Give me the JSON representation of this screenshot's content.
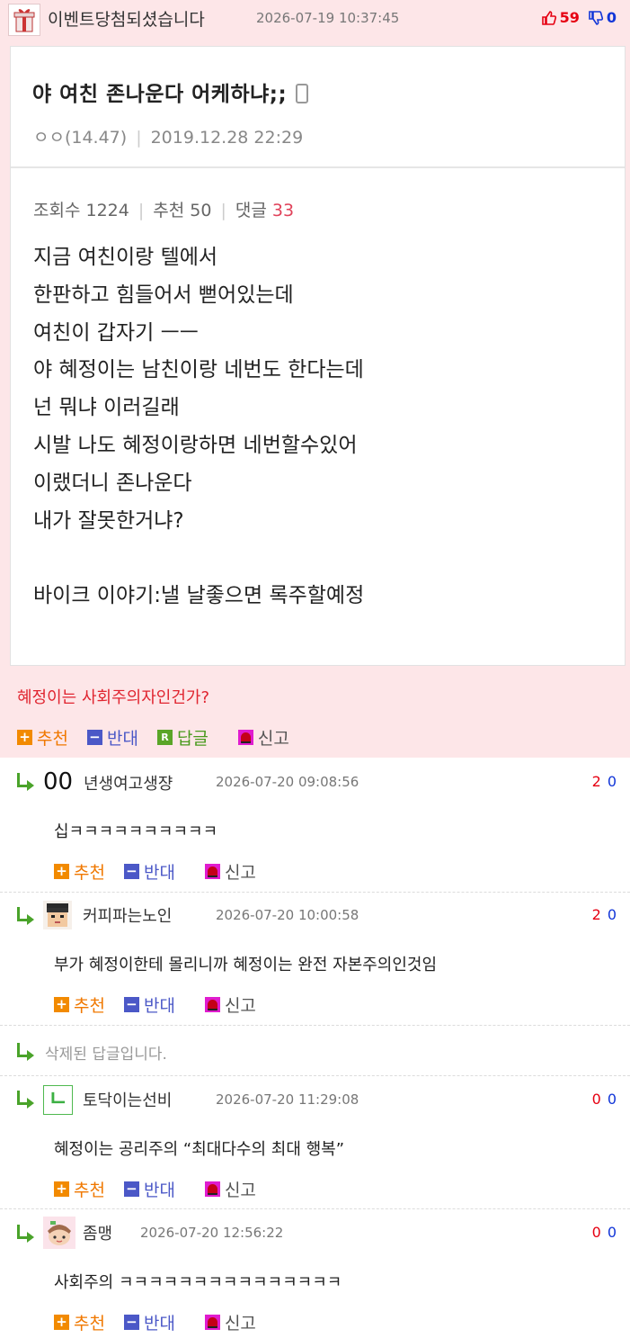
{
  "post": {
    "author": "이벤트당첨되셨습니다",
    "date": "2026-07-19 10:37:45",
    "upvotes": "59",
    "downvotes": "0",
    "embed": {
      "title": "야 여친 존나운다 어케하냐;;",
      "author": "ㅇㅇ(14.47)",
      "date": "2019.12.28 22:29",
      "views": "조회수 1224",
      "recommend": "추천 50",
      "comments_label": "댓글",
      "comments_count": "33",
      "body": [
        "지금 여친이랑 텔에서",
        "한판하고 힘들어서 뻗어있는데",
        "여친이 갑자기 ㅡㅡ",
        "야 혜정이는 남친이랑 네번도 한다는데",
        "넌 뭐냐 이러길래",
        "시발 나도 혜정이랑하면 네번할수있어",
        "이랬더니 존나운다",
        "내가 잘못한거냐?",
        "",
        "바이크 이야기:낼 날좋으면 록주할예정"
      ]
    },
    "question": "혜정이는 사회주의자인건가?",
    "actions": {
      "up": "추천",
      "down": "반대",
      "reply": "답글",
      "reply_icon": "R",
      "report": "신고"
    }
  },
  "comments": [
    {
      "nickname": "00",
      "nickname2": "년생여고생쟝",
      "date": "2026-07-20 09:08:56",
      "up": "2",
      "down": "0",
      "text": "십ㅋㅋㅋㅋㅋㅋㅋㅋㅋㅋ",
      "avatar": "none"
    },
    {
      "nickname": "커피파는노인",
      "date": "2026-07-20 10:00:58",
      "up": "2",
      "down": "0",
      "text": "부가 혜정이한테 몰리니까 혜정이는 완전 자본주의인것임",
      "avatar": "pixel-face-icon"
    },
    {
      "deleted": "삭제된 답글입니다."
    },
    {
      "nickname": "토닥이는선비",
      "date": "2026-07-20 11:29:08",
      "up": "0",
      "down": "0",
      "text": "혜정이는 공리주의 “최대다수의 최대 행복”",
      "avatar": "green-glyph-icon",
      "avatar_glyph": "ㄴ"
    },
    {
      "nickname": "좀맹",
      "date": "2026-07-20 12:56:22",
      "up": "0",
      "down": "0",
      "text": "사회주의 ㅋㅋㅋㅋㅋㅋㅋㅋㅋㅋㅋㅋㅋㅋㅋ",
      "avatar": "cartoon-character-icon"
    }
  ],
  "comment_actions": {
    "up": "추천",
    "down": "반대",
    "report": "신고"
  },
  "colors": {
    "post_bg": "#fde6e8",
    "up": "#e60012",
    "down": "#1236d8",
    "accent_orange": "#f28a00",
    "accent_blue": "#4b58c7",
    "reply_green": "#4aa32a"
  }
}
